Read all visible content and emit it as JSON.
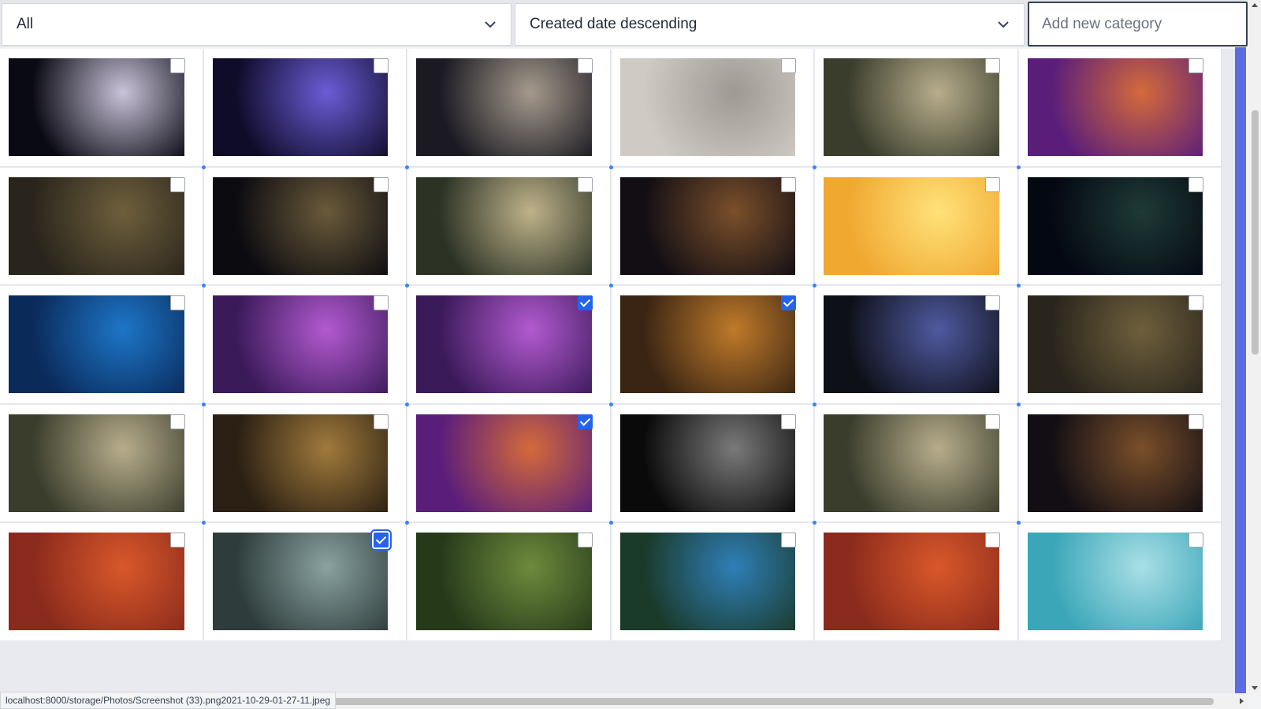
{
  "toolbar": {
    "category_filter": "All",
    "sort_order": "Created date descending",
    "new_category_placeholder": "Add new category"
  },
  "photos": [
    {
      "row": 1,
      "col": 1,
      "selected": false,
      "colors": [
        "#0a0a14",
        "#c9c3d9"
      ]
    },
    {
      "row": 1,
      "col": 2,
      "selected": false,
      "colors": [
        "#0f0c2a",
        "#6b5cd6"
      ]
    },
    {
      "row": 1,
      "col": 3,
      "selected": false,
      "colors": [
        "#1b1a22",
        "#a59a8c"
      ]
    },
    {
      "row": 1,
      "col": 4,
      "selected": false,
      "colors": [
        "#cfcac4",
        "#9e9a92"
      ]
    },
    {
      "row": 1,
      "col": 5,
      "selected": false,
      "colors": [
        "#3a3d2c",
        "#b8ad8c"
      ]
    },
    {
      "row": 1,
      "col": 6,
      "selected": false,
      "colors": [
        "#5a1d7a",
        "#d46a3a"
      ]
    },
    {
      "row": 2,
      "col": 1,
      "selected": false,
      "colors": [
        "#2a251c",
        "#6e5f3c"
      ]
    },
    {
      "row": 2,
      "col": 2,
      "selected": false,
      "colors": [
        "#0c0b10",
        "#6a5a3a"
      ]
    },
    {
      "row": 2,
      "col": 3,
      "selected": false,
      "colors": [
        "#2c3325",
        "#bfb28a"
      ]
    },
    {
      "row": 2,
      "col": 4,
      "selected": false,
      "colors": [
        "#120e14",
        "#7a4f2a"
      ]
    },
    {
      "row": 2,
      "col": 5,
      "selected": false,
      "colors": [
        "#f0a830",
        "#ffe27a"
      ]
    },
    {
      "row": 2,
      "col": 6,
      "selected": false,
      "colors": [
        "#040812",
        "#1e3a36"
      ]
    },
    {
      "row": 3,
      "col": 1,
      "selected": false,
      "colors": [
        "#0a2a5a",
        "#1d76c8"
      ]
    },
    {
      "row": 3,
      "col": 2,
      "selected": false,
      "colors": [
        "#3b1a5a",
        "#b35ad0"
      ]
    },
    {
      "row": 3,
      "col": 3,
      "selected": true,
      "colors": [
        "#3b1a5a",
        "#b35ad0"
      ]
    },
    {
      "row": 3,
      "col": 4,
      "selected": true,
      "colors": [
        "#3a2514",
        "#c07a2a"
      ]
    },
    {
      "row": 3,
      "col": 5,
      "selected": false,
      "colors": [
        "#0e1018",
        "#4f5aa0"
      ]
    },
    {
      "row": 3,
      "col": 6,
      "selected": false,
      "colors": [
        "#2a251c",
        "#6e5f3c"
      ]
    },
    {
      "row": 4,
      "col": 1,
      "selected": false,
      "colors": [
        "#3a3d2c",
        "#b8ad8c"
      ]
    },
    {
      "row": 4,
      "col": 2,
      "selected": false,
      "colors": [
        "#2a1f12",
        "#a07a3c"
      ]
    },
    {
      "row": 4,
      "col": 3,
      "selected": true,
      "colors": [
        "#5a1d7a",
        "#d46a3a"
      ]
    },
    {
      "row": 4,
      "col": 4,
      "selected": false,
      "colors": [
        "#0a0a0a",
        "#7a7a7a"
      ]
    },
    {
      "row": 4,
      "col": 5,
      "selected": false,
      "colors": [
        "#3a3d2c",
        "#b8ad8c"
      ]
    },
    {
      "row": 4,
      "col": 6,
      "selected": false,
      "colors": [
        "#120e14",
        "#7a4f2a"
      ]
    },
    {
      "row": 5,
      "col": 1,
      "selected": false,
      "colors": [
        "#8a2a1c",
        "#d9582a"
      ]
    },
    {
      "row": 5,
      "col": 2,
      "selected": true,
      "colors": [
        "#2e3d3c",
        "#8aa2a0"
      ]
    },
    {
      "row": 5,
      "col": 3,
      "selected": false,
      "colors": [
        "#263a1a",
        "#6e8a3c"
      ]
    },
    {
      "row": 5,
      "col": 4,
      "selected": false,
      "colors": [
        "#1a3a2a",
        "#2f7fb8"
      ]
    },
    {
      "row": 5,
      "col": 5,
      "selected": false,
      "colors": [
        "#8a2a1c",
        "#d9582a"
      ]
    },
    {
      "row": 5,
      "col": 6,
      "selected": false,
      "colors": [
        "#3aa6b8",
        "#a9dfe6"
      ]
    }
  ],
  "status_bar": {
    "url": "localhost:8000/storage/Photos/Screenshot (33).png2021-10-29-01-27-11.jpeg"
  },
  "colors": {
    "accent": "#2563eb",
    "side_bar": "#5b6ee1"
  }
}
